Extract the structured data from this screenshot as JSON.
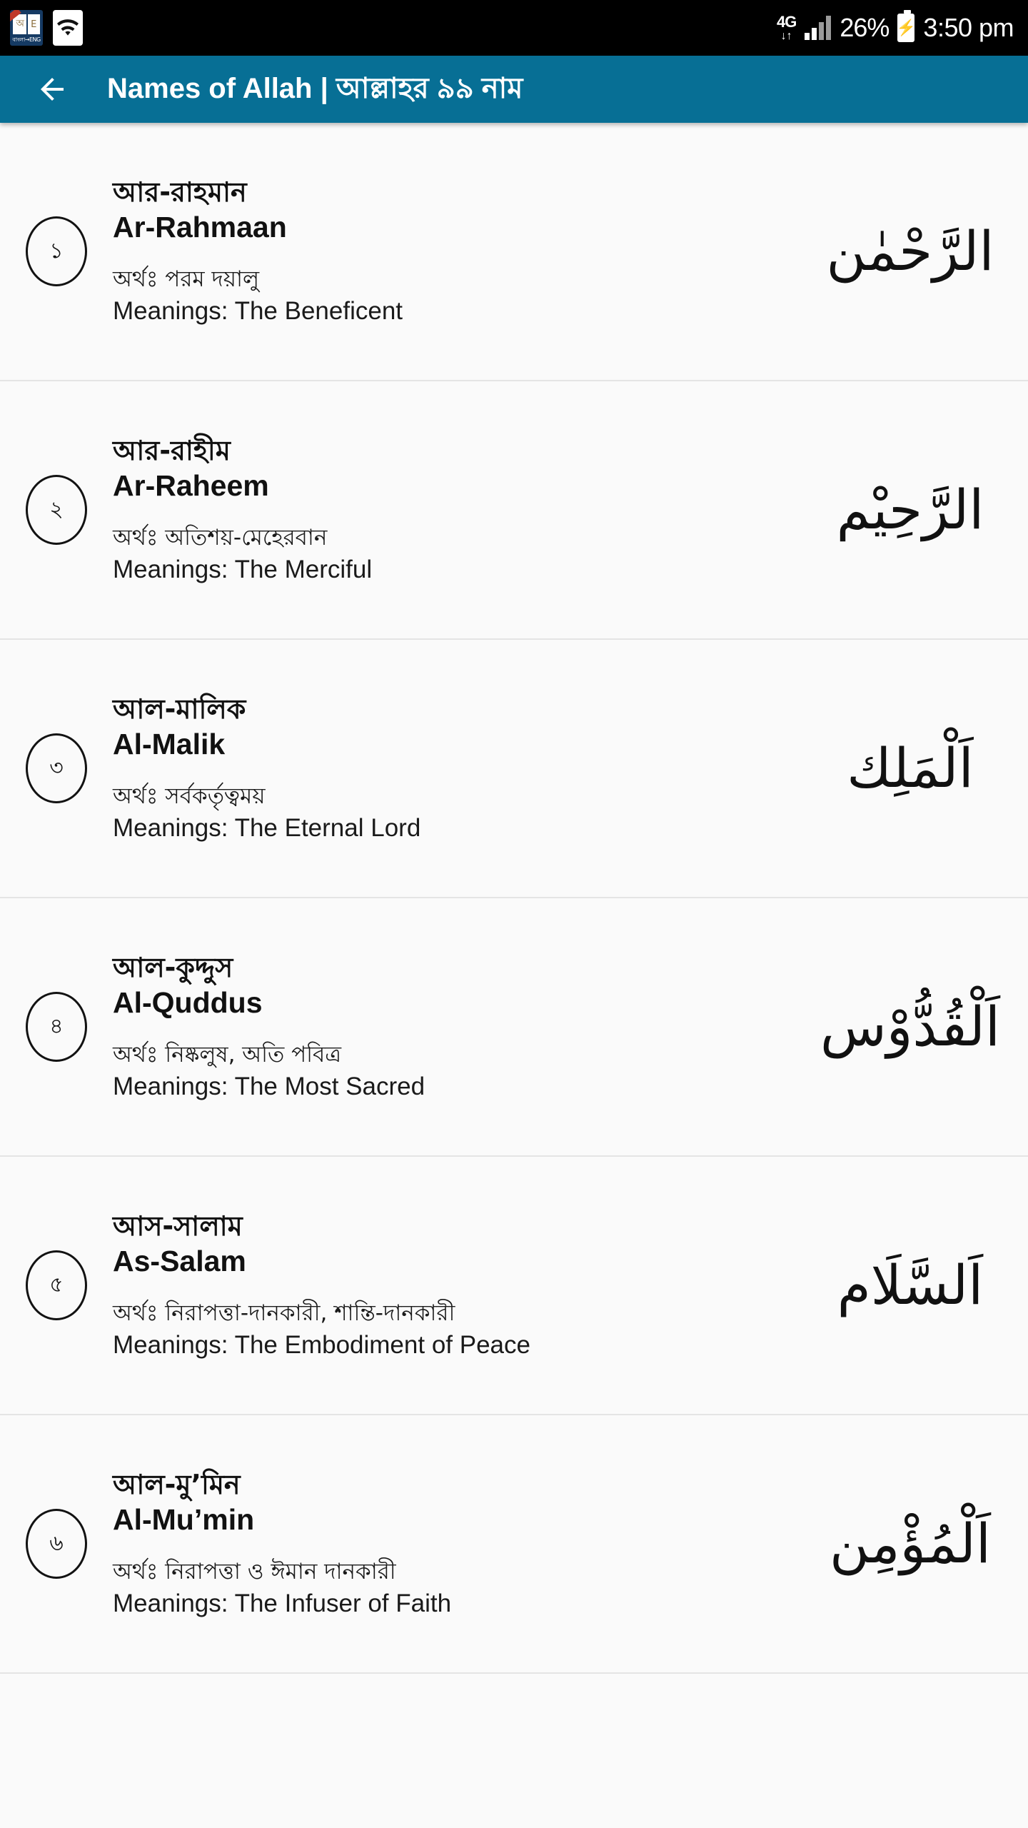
{
  "status_bar": {
    "icons": [
      {
        "name": "dictionary-app-icon",
        "glyph": "dictionary"
      },
      {
        "name": "wifi-icon",
        "glyph": "wifi"
      }
    ],
    "network_type": "4G",
    "data_arrows": "↓↑",
    "signal": "signal-bars-icon",
    "battery_percent": "26%",
    "battery_state": "charging",
    "time": "3:50 pm"
  },
  "app_bar": {
    "back_icon": "back-arrow-icon",
    "title": "Names of Allah | আল্লাহর ৯৯ নাম"
  },
  "list": {
    "items": [
      {
        "index": "১",
        "name_bn": "আর-রাহমান",
        "name_en": "Ar-Rahmaan",
        "meaning_bn": "অর্থঃ পরম দয়ালু",
        "meaning_en": "Meanings: The Beneficent",
        "arabic": "الرَّحْمٰن"
      },
      {
        "index": "২",
        "name_bn": "আর-রাহীম",
        "name_en": "Ar-Raheem",
        "meaning_bn": "অর্থঃ অতিশয়-মেহেরবান",
        "meaning_en": "Meanings: The Merciful",
        "arabic": "الرَّحِيْم"
      },
      {
        "index": "৩",
        "name_bn": "আল-মালিক",
        "name_en": "Al-Malik",
        "meaning_bn": "অর্থঃ সর্বকর্তৃত্বময়",
        "meaning_en": "Meanings: The Eternal Lord",
        "arabic": "اَلْمَلِك"
      },
      {
        "index": "৪",
        "name_bn": "আল-কুদ্দুস",
        "name_en": "Al-Quddus",
        "meaning_bn": "অর্থঃ নিষ্কলুষ, অতি পবিত্র",
        "meaning_en": "Meanings: The Most Sacred",
        "arabic": "اَلْقُدُّوْس"
      },
      {
        "index": "৫",
        "name_bn": "আস-সালাম",
        "name_en": "As-Salam",
        "meaning_bn": "অর্থঃ নিরাপত্তা-দানকারী, শান্তি-দানকারী",
        "meaning_en": "Meanings: The Embodiment of Peace",
        "arabic": "اَلسَّلَام"
      },
      {
        "index": "৬",
        "name_bn": "আল-মু’মিন",
        "name_en": "Al-Mu’min",
        "meaning_bn": "অর্থঃ নিরাপত্তা ও ঈমান দানকারী",
        "meaning_en": "Meanings: The Infuser of Faith",
        "arabic": "اَلْمُؤْمِن"
      }
    ]
  },
  "colors": {
    "app_bar": "#076f95",
    "status_bar": "#000000",
    "list_bg": "#fafafa",
    "divider": "#e4e4e4",
    "text": "#111111"
  }
}
